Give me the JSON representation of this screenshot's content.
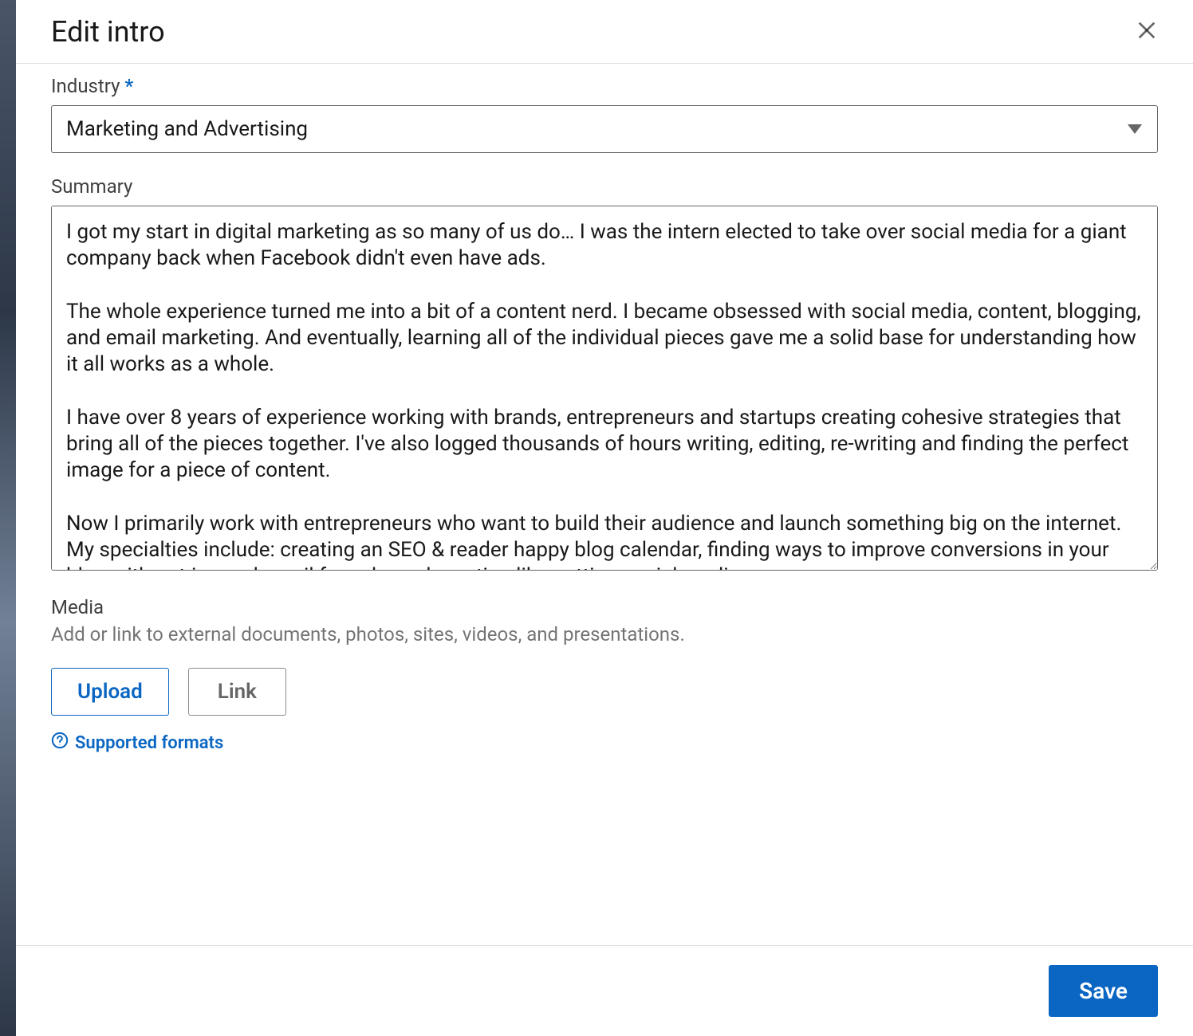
{
  "modal": {
    "title": "Edit intro"
  },
  "industry": {
    "label": "Industry",
    "required_marker": "*",
    "value": "Marketing and Advertising"
  },
  "summary": {
    "label": "Summary",
    "value": "I got my start in digital marketing as so many of us do… I was the intern elected to take over social media for a giant company back when Facebook didn't even have ads.\n\nThe whole experience turned me into a bit of a content nerd. I became obsessed with social media, content, blogging, and email marketing. And eventually, learning all of the individual pieces gave me a solid base for understanding how it all works as a whole.\n\nI have over 8 years of experience working with brands, entrepreneurs and startups creating cohesive strategies that bring all of the pieces together. I've also logged thousands of hours writing, editing, re-writing and finding the perfect image for a piece of content.\n\nNow I primarily work with entrepreneurs who want to build their audience and launch something big on the internet. My specialties include: creating an SEO & reader happy blog calendar, finding ways to improve conversions in your blog with opt-ins and email funnels, and creating like-getting social media"
  },
  "media": {
    "label": "Media",
    "helper": "Add or link to external documents, photos, sites, videos, and presentations.",
    "upload_label": "Upload",
    "link_label": "Link",
    "supported_formats_label": "Supported formats"
  },
  "footer": {
    "save_label": "Save"
  }
}
